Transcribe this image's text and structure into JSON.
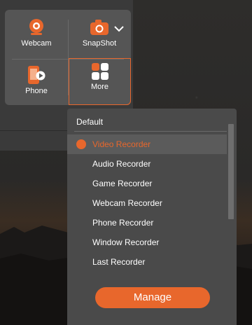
{
  "modes": {
    "webcam": {
      "label": "Webcam",
      "icon": "webcam-icon"
    },
    "snapshot": {
      "label": "SnapShot",
      "icon": "camera-icon"
    },
    "phone": {
      "label": "Phone",
      "icon": "phone-icon"
    },
    "more": {
      "label": "More",
      "icon": "grid-icon"
    }
  },
  "dropdown": {
    "title": "Default",
    "items": [
      {
        "label": "Video Recorder",
        "selected": true
      },
      {
        "label": "Audio Recorder"
      },
      {
        "label": "Game Recorder"
      },
      {
        "label": "Webcam Recorder"
      },
      {
        "label": "Phone Recorder"
      },
      {
        "label": "Window Recorder"
      },
      {
        "label": "Last Recorder"
      }
    ],
    "manage_label": "Manage"
  },
  "colors": {
    "accent": "#e8672c",
    "card": "#555555",
    "menu": "#4a4a4a"
  }
}
